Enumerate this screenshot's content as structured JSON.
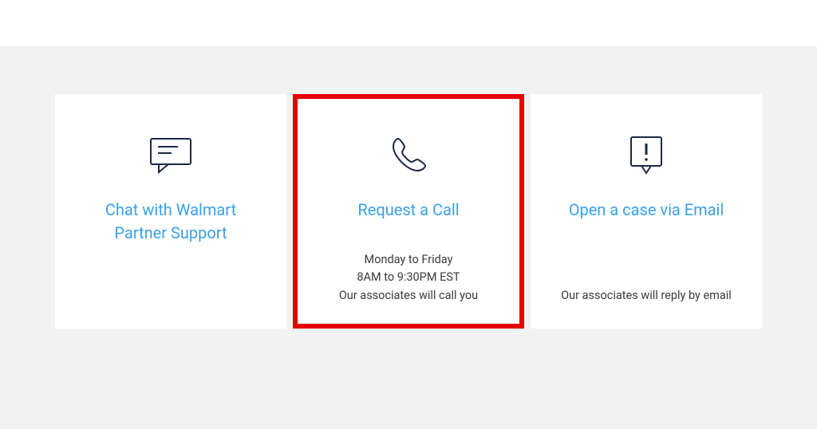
{
  "cards": {
    "chat": {
      "title": "Chat with Walmart Partner Support",
      "desc": ""
    },
    "call": {
      "title": "Request a Call",
      "desc_line1": "Monday to Friday",
      "desc_line2": "8AM to 9:30PM EST",
      "desc_line3": "Our associates will call you"
    },
    "email": {
      "title": "Open a case via Email",
      "desc": "Our associates will reply by email"
    }
  },
  "colors": {
    "link": "#3aa0e8",
    "icon": "#1a2846",
    "highlight": "#e40000"
  }
}
